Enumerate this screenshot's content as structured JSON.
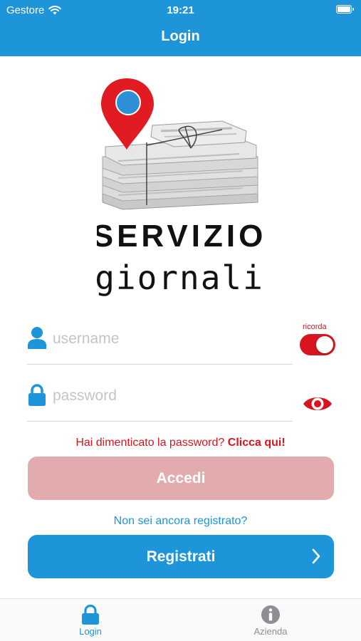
{
  "status_bar": {
    "carrier": "Gestore",
    "time": "19:21"
  },
  "nav": {
    "title": "Login"
  },
  "logo": {
    "line1": "SERVIZIO",
    "line2": "giornali"
  },
  "form": {
    "username_placeholder": "username",
    "password_placeholder": "password",
    "remember_label": "ricorda",
    "remember_on": true,
    "forgot_text": "Hai dimenticato la password?",
    "forgot_link": "Clicca qui!",
    "login_button": "Accedi",
    "not_registered": "Non sei ancora registrato?",
    "register_button": "Registrati"
  },
  "tabs": [
    {
      "label": "Login",
      "icon": "lock-icon",
      "active": true
    },
    {
      "label": "Azienda",
      "icon": "info-icon",
      "active": false
    }
  ],
  "colors": {
    "primary": "#1d95d8",
    "accent": "#d8151f",
    "disabled": "#e2acae",
    "inactive": "#8e8e93"
  }
}
